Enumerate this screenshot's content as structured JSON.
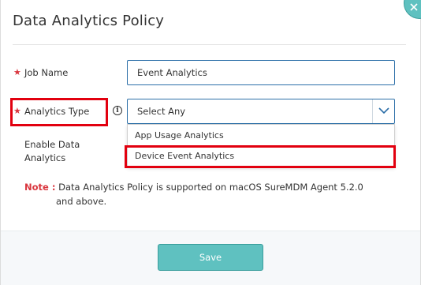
{
  "dialog": {
    "title": "Data Analytics Policy"
  },
  "form": {
    "required_marker": "★",
    "job_name": {
      "label": "Job Name",
      "value": "Event Analytics"
    },
    "analytics_type": {
      "label": "Analytics Type",
      "selected": "Select Any",
      "options": [
        "App Usage Analytics",
        "Device Event Analytics"
      ]
    },
    "enable_data_analytics": {
      "label_line1": "Enable Data",
      "label_line2": "Analytics"
    }
  },
  "note": {
    "label": "Note :",
    "text_line1": "Data Analytics Policy is supported on macOS SureMDM Agent 5.2.0",
    "text_line2": "and above."
  },
  "footer": {
    "save_label": "Save"
  },
  "icons": {
    "close": "close-icon",
    "info": "info-icon",
    "dropdown": "chevron-down-icon"
  },
  "colors": {
    "accent": "#5fc1c0",
    "required": "#d9363e",
    "highlight": "#e2000f",
    "input_border": "#2c6fa8"
  }
}
